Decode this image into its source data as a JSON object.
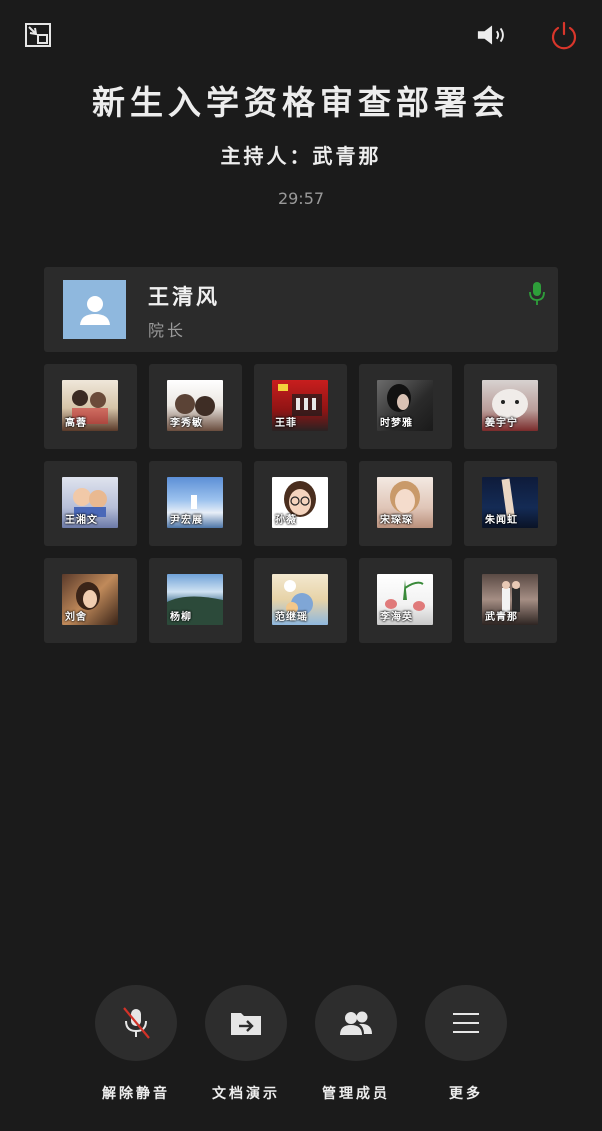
{
  "header": {
    "title": "新生入学资格审查部署会",
    "host": "主持人：武青那",
    "timer": "29:57"
  },
  "speaker": {
    "name": "王清风",
    "role": "院长"
  },
  "participants": [
    {
      "name": "高蓉"
    },
    {
      "name": "李秀敏"
    },
    {
      "name": "王菲"
    },
    {
      "name": "时梦雅"
    },
    {
      "name": "姜宇宁"
    },
    {
      "name": "王湘文"
    },
    {
      "name": "尹宏展"
    },
    {
      "name": "孙薇"
    },
    {
      "name": "宋琛琛"
    },
    {
      "name": "朱闻虹"
    },
    {
      "name": "刘舍"
    },
    {
      "name": "杨柳"
    },
    {
      "name": "范继瑶"
    },
    {
      "name": "李海英"
    },
    {
      "name": "武青那"
    }
  ],
  "toolbar": {
    "unmute_label": "解除静音",
    "docs_label": "文档演示",
    "members_label": "管理成员",
    "more_label": "更多"
  },
  "colors": {
    "background": "#1b1b1b",
    "card": "#2b2b2b",
    "mic_active": "#2e9e3a",
    "power": "#d9362b",
    "mute_slash": "#d23228"
  }
}
